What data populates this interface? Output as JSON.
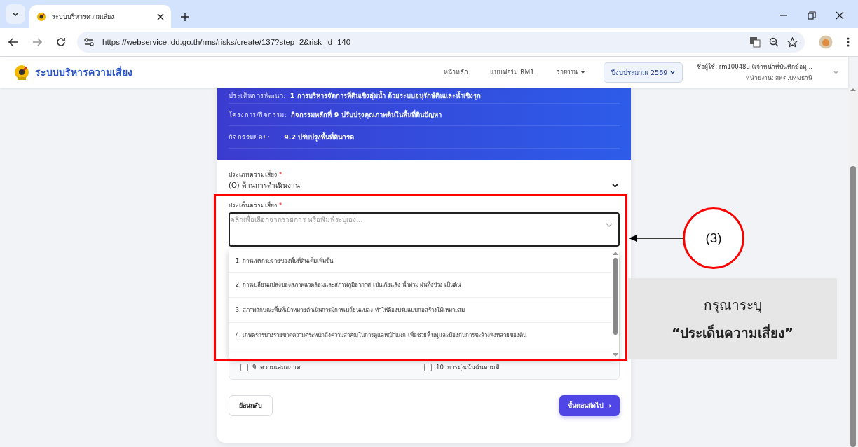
{
  "browser": {
    "tab_title": "ระบบบริหารความเสี่ยง",
    "url": "https://webservice.ldd.go.th/rms/risks/create/137?step=2&risk_id=140"
  },
  "app": {
    "title": "ระบบบริหารความเสี่ยง",
    "nav": [
      {
        "label": "หน้าหลัก",
        "dropdown": false
      },
      {
        "label": "แบบฟอร์ม RM1",
        "dropdown": false
      },
      {
        "label": "รายงาน",
        "dropdown": true
      }
    ],
    "fiscal_year": "ปีงบประมาณ 2569",
    "user": "ชื่อผู้ใช้: rm10048u (เจ้าหน้าที่บันทึกข้อมู...",
    "unit": "หน่วยงาน: สพด.ปทุมธานี"
  },
  "summary": [
    {
      "label": "ประเด็นการพัฒนา:",
      "value": "1 การบริหารจัดการที่ดินเชิงลุ่มน้ำ ด้วยระบบอนุรักษ์ดินและน้ำเชิงรุก"
    },
    {
      "label": "โครงการ/กิจกรรม:",
      "value": "กิจกรรมหลักที่ 9 ปรับปรุงคุณภาพดินในพื้นที่ดินปัญหา"
    },
    {
      "label": "กิจกรรมย่อย:",
      "value": "9.2 ปรับปรุงพื้นที่ดินกรด"
    }
  ],
  "form": {
    "risk_type": {
      "label": "ประเภทความเสี่ยง",
      "required_mark": "*",
      "value": "(O) ด้านการดำเนินงาน"
    },
    "risk_issue": {
      "label": "ประเด็นความเสี่ยง",
      "required_mark": "*",
      "placeholder": "คลิกเพื่อเลือกจากรายการ หรือพิมพ์ระบุเอง..."
    },
    "options": [
      {
        "label": "1. การแพร่กระจายของพื้นที่ดินเค็มเพิ่มขึ้น"
      },
      {
        "label": "2. การเปลี่ยนแปลงของสภาพแวดล้อมและสภาพภูมิอากาศ เช่น ภัยแล้ง น้ำท่วม ฝนทิ้งช่วง เป็นต้น"
      },
      {
        "label": "3. สภาพลักษณะพื้นที่เป้าหมายดำเนินการมีการเปลี่ยนแปลง ทำให้ต้องปรับแบบก่อสร้างให้เหมาะสม"
      },
      {
        "label": "4. เกษตรกรบางรายขาดความตระหนักถึงความสำคัญในการดูแลหญ้าแฝก เพื่อช่วยฟื้นฟูและป้องกันการชะล้างพังทลายของดิน"
      }
    ],
    "principles": [
      {
        "label": "9. ความเสมอภาค",
        "checked": false
      },
      {
        "label": "10. การมุ่งเน้นฉันทามติ",
        "checked": false
      }
    ]
  },
  "buttons": {
    "back": "ย้อนกลับ",
    "next": "ขั้นตอนถัดไป",
    "next_arrow": "→"
  },
  "annotation": {
    "step": "(3)",
    "note": "กรุณาระบุ",
    "note_emphasis": "“ประเด็นความเสี่ยง”"
  }
}
